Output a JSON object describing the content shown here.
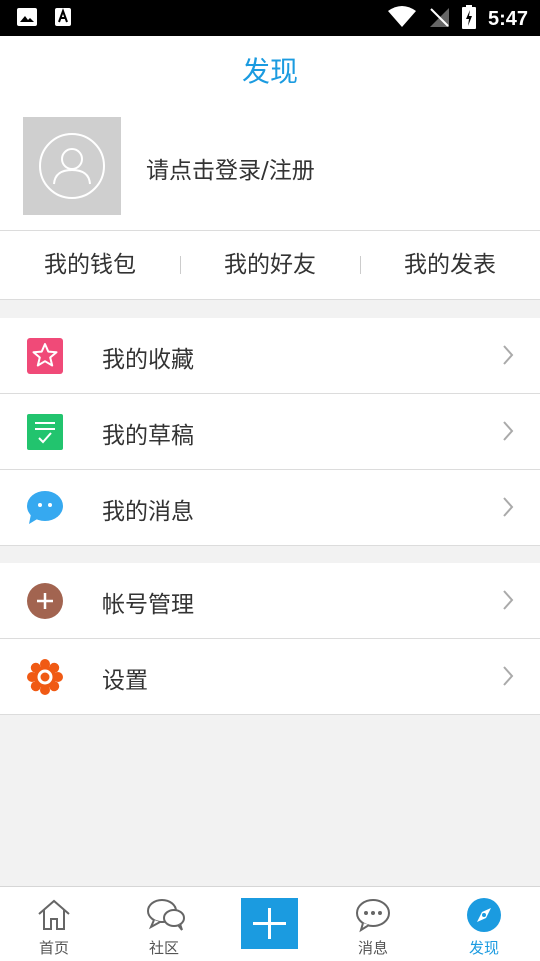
{
  "status_bar": {
    "time": "5:47"
  },
  "header": {
    "title": "发现"
  },
  "profile": {
    "login_prompt": "请点击登录/注册"
  },
  "shortcuts": [
    {
      "label": "我的钱包"
    },
    {
      "label": "我的好友"
    },
    {
      "label": "我的发表"
    }
  ],
  "menu_group_1": [
    {
      "label": "我的收藏",
      "icon": "star-icon",
      "color": "#f04a78"
    },
    {
      "label": "我的草稿",
      "icon": "draft-icon",
      "color": "#22c46e"
    },
    {
      "label": "我的消息",
      "icon": "message-bubble-icon",
      "color": "#36a9f0"
    }
  ],
  "menu_group_2": [
    {
      "label": "帐号管理",
      "icon": "plus-circle-icon",
      "color": "#a26450"
    },
    {
      "label": "设置",
      "icon": "gear-icon",
      "color": "#f05a14"
    }
  ],
  "tab_bar": {
    "tabs": [
      {
        "label": "首页",
        "icon": "home-icon"
      },
      {
        "label": "社区",
        "icon": "community-icon"
      },
      {
        "label": "",
        "icon": "plus-icon"
      },
      {
        "label": "消息",
        "icon": "chat-icon"
      },
      {
        "label": "发现",
        "icon": "compass-icon",
        "active": true
      }
    ]
  },
  "colors": {
    "accent": "#1b9be0"
  }
}
